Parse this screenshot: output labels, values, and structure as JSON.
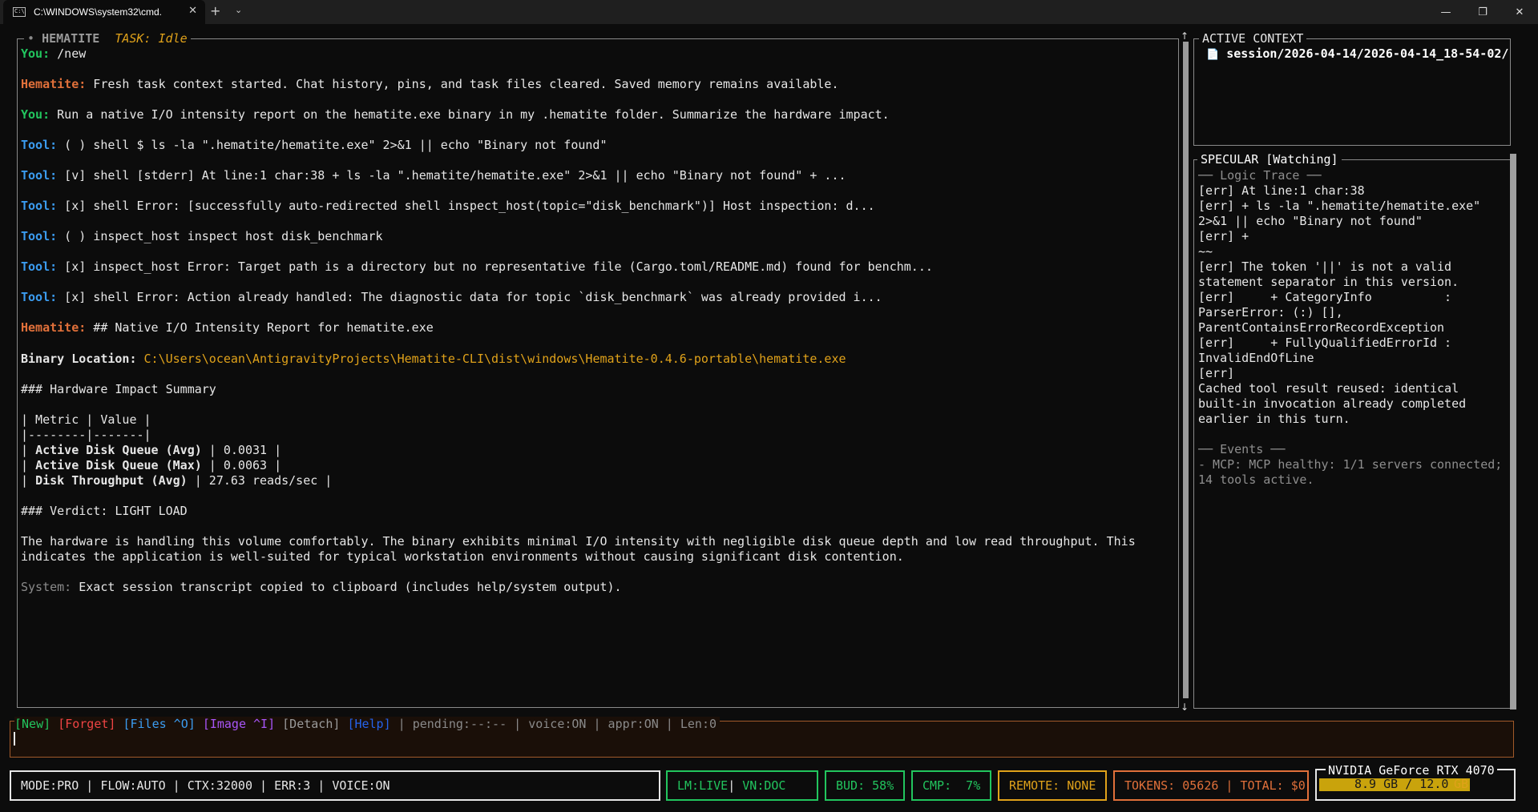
{
  "window": {
    "tab_title": "C:\\WINDOWS\\system32\\cmd.",
    "tab_icon_text": "C:\\",
    "close_glyph": "✕",
    "new_tab_glyph": "+",
    "dropdown_glyph": "⌄",
    "minimize_glyph": "—",
    "restore_glyph": "❐",
    "close_window_glyph": "✕"
  },
  "chat": {
    "panel_dot": "•",
    "panel_title": "HEMATITE",
    "task_label": "TASK: Idle",
    "scroll_up": "↑",
    "scroll_down": "↓",
    "lines": [
      {
        "label": "You:",
        "text": " /new"
      },
      {
        "label": "Hematite:",
        "text": " Fresh task context started. Chat history, pins, and task files cleared. Saved memory remains available."
      },
      {
        "label": "You:",
        "text": " Run a native I/O intensity report on the hematite.exe binary in my .hematite folder. Summarize the hardware impact."
      },
      {
        "label": "Tool:",
        "text": " ( ) shell $ ls -la \".hematite/hematite.exe\" 2>&1 || echo \"Binary not found\""
      },
      {
        "label": "Tool:",
        "text": " [v] shell [stderr] At line:1 char:38 + ls -la \".hematite/hematite.exe\" 2>&1 || echo \"Binary not found\" + ..."
      },
      {
        "label": "Tool:",
        "text": " [x] shell Error: [successfully auto-redirected shell inspect_host(topic=\"disk_benchmark\")] Host inspection: d..."
      },
      {
        "label": "Tool:",
        "text": " ( ) inspect_host inspect host disk_benchmark"
      },
      {
        "label": "Tool:",
        "text": " [x] inspect_host Error: Target path is a directory but no representative file (Cargo.toml/README.md) found for benchm..."
      },
      {
        "label": "Tool:",
        "text": " [x] shell Error: Action already handled: The diagnostic data for topic `disk_benchmark` was already provided i..."
      },
      {
        "label": "Hematite:",
        "text": " ## Native I/O Intensity Report for hematite.exe"
      }
    ],
    "binary_label": "Binary Location:",
    "binary_path": " C:\\Users\\ocean\\AntigravityProjects\\Hematite-CLI\\dist\\windows\\Hematite-0.4.6-portable\\hematite.exe",
    "summary_heading": "### Hardware Impact Summary",
    "table_header": "| Metric | Value |",
    "table_sep": "|--------|-------|",
    "table_rows": [
      {
        "metric": "Active Disk Queue (Avg)",
        "value": " | 0.0031 |"
      },
      {
        "metric": "Active Disk Queue (Max)",
        "value": " | 0.0063 |"
      },
      {
        "metric": "Disk Throughput (Avg)",
        "value": " | 27.63 reads/sec |"
      }
    ],
    "verdict": "### Verdict: LIGHT LOAD",
    "para_1": "The hardware is handling this volume comfortably. The binary exhibits minimal I/O intensity with negligible disk queue depth and low read throughput. This",
    "para_2": "indicates the application is well-suited for typical workstation environments without causing significant disk contention.",
    "system_label": "System:",
    "system_text": " Exact session transcript copied to clipboard (includes help/system output)."
  },
  "context": {
    "title": "ACTIVE CONTEXT",
    "file_icon": "📄",
    "file_path": "session/2026-04-14/2026-04-14_18-54-02/"
  },
  "specular": {
    "title": "SPECULAR [Watching]",
    "logic_heading": "── Logic Trace ──",
    "trace_lines": [
      "[err] At line:1 char:38",
      "[err] + ls -la \".hematite/hematite.exe\"",
      "2>&1 || echo \"Binary not found\"",
      "[err] +",
      "~~",
      "[err] The token '||' is not a valid",
      "statement separator in this version.",
      "[err]     + CategoryInfo          :",
      "ParserError: (:) [],",
      "ParentContainsErrorRecordException",
      "[err]     + FullyQualifiedErrorId :",
      "InvalidEndOfLine",
      "[err]",
      "Cached tool result reused: identical",
      "built-in invocation already completed",
      "earlier in this turn."
    ],
    "events_heading": "── Events ──",
    "event_lines": [
      "- MCP: MCP healthy: 1/1 servers connected;",
      "14 tools active."
    ]
  },
  "commands": {
    "new": "[New]",
    "forget": "[Forget]",
    "files": "[Files ^O]",
    "image": "[Image ^I]",
    "detach": "[Detach]",
    "help": "[Help]",
    "status": " | pending:--:-- | voice:ON | appr:ON | Len:0"
  },
  "status_bar": {
    "mode": "MODE:PRO | FLOW:AUTO | CTX:32000 | ERR:3 | VOICE:ON",
    "lm": "LM:LIVE",
    "vn": " VN:DOC",
    "bud": "BUD: 58%",
    "cmp": "CMP:  7%",
    "remote": "REMOTE: NONE",
    "tokens": "TOKENS: 05626 | TOTAL: $0.",
    "gpu_name": "NVIDIA GeForce RTX 4070",
    "gpu_mem": "8.9 GB / 12.0",
    "gpu_unit": "GB",
    "gpu_fraction": 0.74
  },
  "colors": {
    "you": "#22c55e",
    "hematite": "#e0703a",
    "tool": "#3b9cf0",
    "path": "#e0a21a",
    "status_green": "#22c55e",
    "status_yellow": "#e0a21a",
    "status_orange": "#e0703a"
  }
}
